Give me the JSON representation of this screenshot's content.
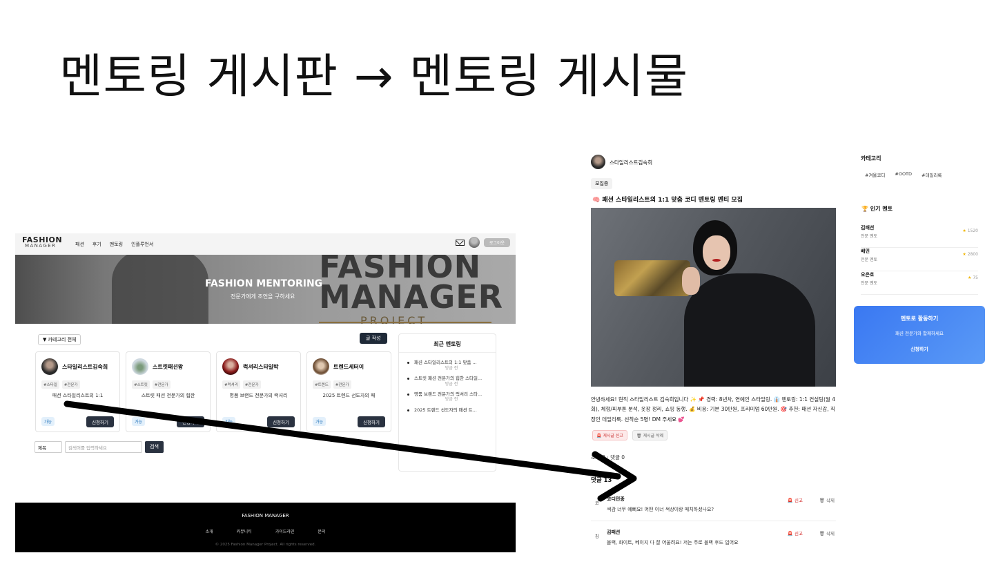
{
  "slide": {
    "title": "멘토링 게시판 → 멘토링 게시물"
  },
  "board": {
    "nav": {
      "logo_top": "FASHION",
      "logo_bottom": "MANAGER",
      "menu": [
        "패션",
        "후기",
        "멘토링",
        "인플루언서"
      ],
      "logout": "로그아웃"
    },
    "hero": {
      "big_text_1": "FASHION",
      "big_text_2": "MANAGER",
      "project": "PROJECT",
      "title": "FASHION MENTORING",
      "subtitle": "전문가에게 조언을 구하세요"
    },
    "category_select": "▼ 카테고리 전체",
    "write_button": "글 작성",
    "cards": [
      {
        "name": "스타일리스트김숙희",
        "tags": [
          "#스타일",
          "#전문가"
        ],
        "text": "패션 스타일리스트의 1:1",
        "status": "가능",
        "apply": "신청하기"
      },
      {
        "name": "스트릿패션왕",
        "tags": [
          "#스트릿",
          "#전문가"
        ],
        "text": "스트릿 패션 전문가의 힙한",
        "status": "가능",
        "apply": "신청하기"
      },
      {
        "name": "럭셔리스타일박",
        "tags": [
          "#럭셔리",
          "#전문가"
        ],
        "text": "명품 브랜드 전문가의 럭셔리",
        "status": "가능",
        "apply": "신청하기"
      },
      {
        "name": "트렌드세터이",
        "tags": [
          "#트렌드",
          "#전문가"
        ],
        "text": "2025 트렌드 선도자의 패",
        "status": "가능",
        "apply": "신청하기"
      }
    ],
    "recent": {
      "title": "최근 멘토링",
      "items": [
        {
          "text": "패션 스타일리스트의 1:1 맞춤 ...",
          "time": "방금 전"
        },
        {
          "text": "스트릿 패션 전문가의 힙한 스타일...",
          "time": "방금 전"
        },
        {
          "text": "명품 브랜드 전문가의 럭셔리 스타...",
          "time": "방금 전"
        },
        {
          "text": "2025 트렌드 선도자의 패션 트...",
          "time": ""
        }
      ]
    },
    "search": {
      "select": "제목",
      "placeholder": "검색어를 입력하세요",
      "button": "검색"
    },
    "footer": {
      "title": "FASHION MANAGER",
      "links": [
        "소개",
        "커뮤니티",
        "가이드라인",
        "문의"
      ],
      "copyright": "© 2025 Fashion Manager Project. All rights reserved."
    }
  },
  "post": {
    "author": "스타일리스트김숙희",
    "badge": "모집중",
    "title": "🧠 패션 스타일리스트의 1:1 맞춤 코디 멘토링 멘티 모집",
    "body": "안녕하세요! 현직 스타일리스트 김숙희입니다 ✨ 📌 경력: 8년차, 연예인 스타일링. 👔 멘토링: 1:1 컨설팅(월 4회), 체형/피부톤 분석, 옷장 정리, 쇼핑 동행. 💰 비용: 기본 30만원, 프리미엄 60만원. 🎯 추천: 패션 자신감, 직장인 데일리룩. 선착순 5명! DM 주세요 💕",
    "report_button": "🚨 게시글 신고",
    "delete_button": "🗑 게시글 삭제",
    "views": "조회 0 · 댓글 0",
    "comments_title": "댓글 13",
    "comments": [
      {
        "initial": "코",
        "name": "코디민종",
        "text": "색감 너무 예뻐요! 어떤 이너 색상이랑 매치하셨나요?",
        "report": "🚨 신고",
        "delete": "🗑 삭제"
      },
      {
        "initial": "김",
        "name": "김패션",
        "text": "블랙, 화이트, 베이지 다 잘 어울려요! 저는 주로 블랙 후드 입어요",
        "report": "🚨 신고",
        "delete": "🗑 삭제"
      }
    ],
    "sidebar": {
      "category_title": "카테고리",
      "tags": [
        "#겨울코디",
        "#OOTD",
        "#데일리룩"
      ],
      "popular_title": "🏆 인기 멘토",
      "mentors": [
        {
          "name": "김패션",
          "role": "전문 멘토",
          "score": "1520"
        },
        {
          "name": "배민",
          "role": "전문 멘토",
          "score": "2800"
        },
        {
          "name": "오은호",
          "role": "전문 멘토",
          "score": "75"
        }
      ],
      "cta": {
        "title": "멘토로 활동하기",
        "subtitle": "패션 전문가와 함께하세요",
        "apply": "신청하기"
      }
    }
  }
}
